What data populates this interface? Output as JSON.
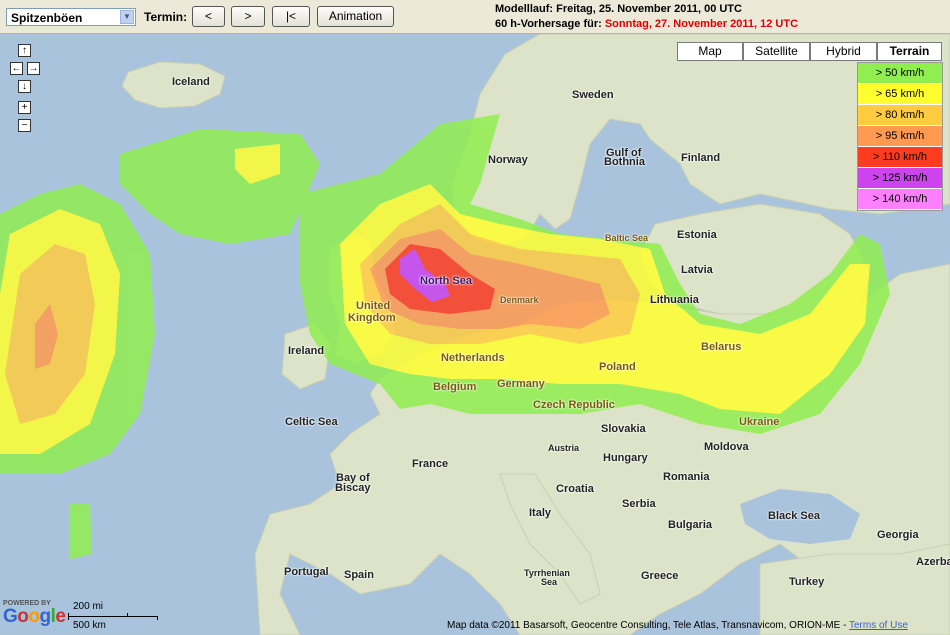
{
  "toolbar": {
    "select_value": "Spitzenböen",
    "termin_label": "Termin:",
    "btn_prev": "<",
    "btn_next": ">",
    "btn_first": "|<",
    "btn_animation": "Animation",
    "modelllauf": "Modelllauf: Freitag, 25. November 2011, 00 UTC",
    "vorhersage_prefix": "60 h-Vorhersage für: ",
    "vorhersage_date": "Sonntag, 27. November 2011, 12 UTC"
  },
  "map_types": [
    "Map",
    "Satellite",
    "Hybrid",
    "Terrain"
  ],
  "active_map_type": "Terrain",
  "nav": {
    "up": "↑",
    "left": "←",
    "right": "→",
    "down": "↓",
    "zoom_in": "+",
    "zoom_out": "−"
  },
  "legend": [
    {
      "label": "> 50 km/h",
      "color": "#90ee50"
    },
    {
      "label": "> 65 km/h",
      "color": "#ffff30"
    },
    {
      "label": "> 80 km/h",
      "color": "#ffcc40"
    },
    {
      "label": "> 95 km/h",
      "color": "#ff9a50"
    },
    {
      "label": "> 110 km/h",
      "color": "#ff3c1e"
    },
    {
      "label": "> 125 km/h",
      "color": "#cc44ee"
    },
    {
      "label": "> 140 km/h",
      "color": "#ff80ff"
    }
  ],
  "labels": {
    "iceland": "Iceland",
    "sweden": "Sweden",
    "norway": "Norway",
    "gulf": "Gulf of",
    "bothnia": "Bothnia",
    "finland": "Finland",
    "estonia": "Estonia",
    "latvia": "Latvia",
    "lithuania": "Lithuania",
    "baltic": "Baltic Sea",
    "north_sea": "North Sea",
    "denmark": "Denmark",
    "united": "United",
    "kingdom": "Kingdom",
    "ireland": "Ireland",
    "netherlands": "Netherlands",
    "belgium": "Belgium",
    "germany": "Germany",
    "poland": "Poland",
    "belarus": "Belarus",
    "czech": "Czech Republic",
    "ukraine": "Ukraine",
    "celtic": "Celtic Sea",
    "slovakia": "Slovakia",
    "austria": "Austria",
    "hungary": "Hungary",
    "moldova": "Moldova",
    "france": "France",
    "romania": "Romania",
    "bay_of": "Bay of",
    "biscay": "Biscay",
    "croatia": "Croatia",
    "serbia": "Serbia",
    "italy": "Italy",
    "bulgaria": "Bulgaria",
    "black_sea": "Black Sea",
    "georgia": "Georgia",
    "portugal": "Portugal",
    "spain": "Spain",
    "tyrrhenian": "Tyrrhenian",
    "sea": "Sea",
    "greece": "Greece",
    "turkey": "Turkey",
    "azerbai": "Azerbai"
  },
  "scale": {
    "miles": "200 mi",
    "km": "500 km"
  },
  "logo": {
    "powered": "POWERED BY",
    "google": "Google"
  },
  "attribution": {
    "text": "Map data ©2011 Basarsoft, Geocentre Consulting, Tele Atlas, Transnavicom, ORION-ME - ",
    "terms": "Terms of Use"
  }
}
